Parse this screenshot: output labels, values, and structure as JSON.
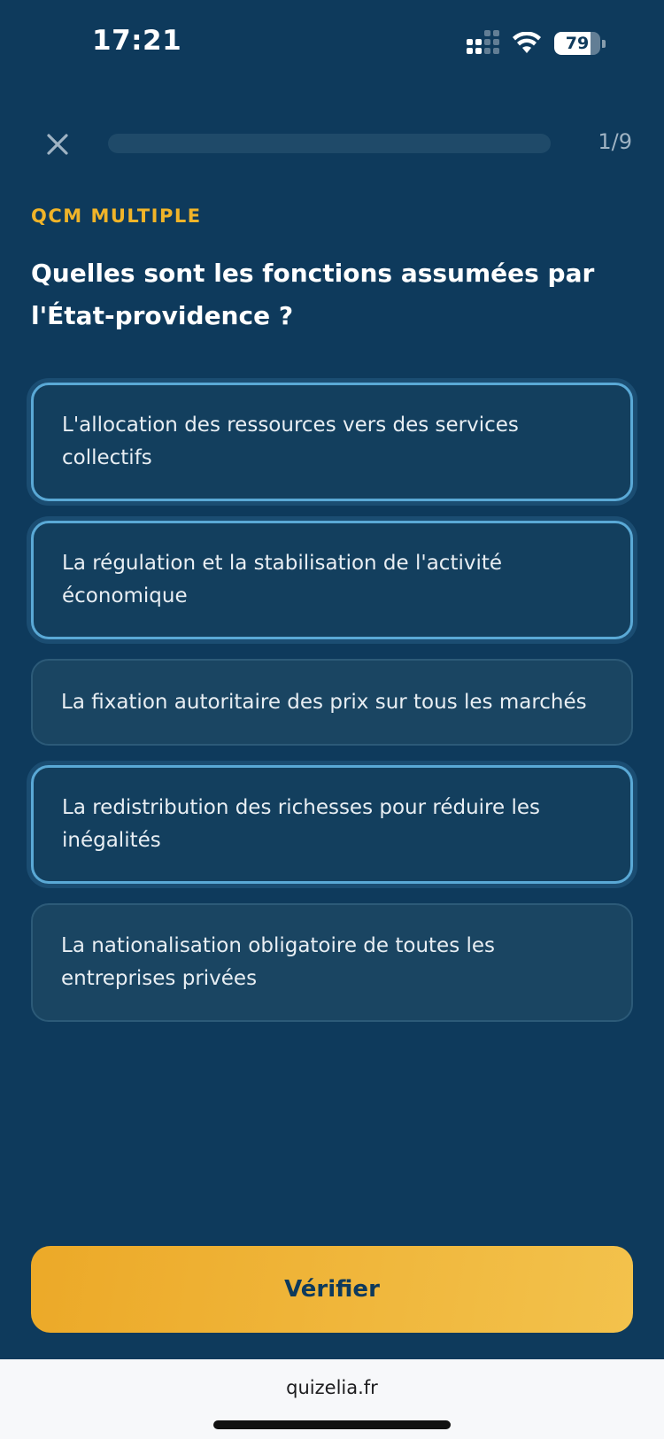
{
  "status_bar": {
    "time": "17:21",
    "battery_level": "79",
    "icons": [
      "signal-icon",
      "wifi-icon",
      "battery-icon"
    ]
  },
  "header": {
    "close_icon": "close-icon",
    "progress_label": "1/9",
    "progress_fraction": 0.0
  },
  "question": {
    "type": "QCM MULTIPLE",
    "text": "Quelles sont les fonctions assumées par l'État-providence ?"
  },
  "options": [
    {
      "label": "L'allocation des ressources vers des services collectifs",
      "selected": true
    },
    {
      "label": "La régulation et la stabilisation de l'activité économique",
      "selected": true
    },
    {
      "label": "La fixation autoritaire des prix sur tous les marchés",
      "selected": false
    },
    {
      "label": "La redistribution des richesses pour réduire les inégalités",
      "selected": true
    },
    {
      "label": "La nationalisation obligatoire de toutes les entreprises privées",
      "selected": false
    }
  ],
  "actions": {
    "verify_label": "Vérifier"
  },
  "browser": {
    "url": "quizelia.fr"
  },
  "colors": {
    "background": "#0e3a5c",
    "accent": "#f0b429",
    "selected_border": "#5aa9d6"
  }
}
